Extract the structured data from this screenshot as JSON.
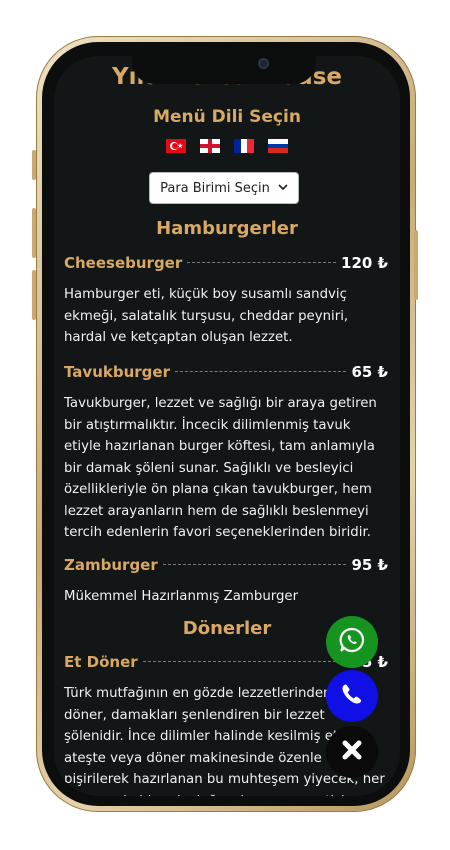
{
  "restaurant": {
    "name": "Yıldız Steakhouse"
  },
  "language": {
    "title": "Menü Dili Seçin",
    "flags": [
      {
        "code": "tr",
        "name": "Turkish flag"
      },
      {
        "code": "en",
        "name": "English flag"
      },
      {
        "code": "fr",
        "name": "French flag"
      },
      {
        "code": "ru",
        "name": "Russian flag"
      }
    ]
  },
  "currency": {
    "label": "Para Birimi Seçin"
  },
  "sections": [
    {
      "title": "Hamburgerler",
      "items": [
        {
          "name": "Cheeseburger",
          "price": "120 ₺",
          "description": "Hamburger eti, küçük boy susamlı sandviç ekmeği, salatalık turşusu, cheddar peyniri, hardal ve ketçaptan oluşan lezzet."
        },
        {
          "name": "Tavukburger",
          "price": "65 ₺",
          "description": "Tavukburger, lezzet ve sağlığı bir araya getiren bir atıştırmalıktır. İncecik dilimlenmiş tavuk etiyle hazırlanan burger köftesi, tam anlamıyla bir damak şöleni sunar. Sağlıklı ve besleyici özellikleriyle ön plana çıkan tavukburger, hem lezzet arayanların hem de sağlıklı beslenmeyi tercih edenlerin favori seçeneklerinden biridir."
        },
        {
          "name": "Zamburger",
          "price": "95 ₺",
          "description": "Mükemmel Hazırlanmış Zamburger"
        }
      ]
    },
    {
      "title": "Dönerler",
      "items": [
        {
          "name": "Et Döner",
          "price": "95 ₺",
          "description": "Türk mutfağının en gözde lezzetlerinden biri et döner, damakları şenlendiren bir lezzet şölenidir. İnce dilimler halinde kesilmiş et, ateşte veya döner makinesinde özenle pişirilerek hazırlanan bu muhteşem yiyecek, her lokmasıyla bir yolculuğa çıkarma garantisi verir."
        }
      ]
    }
  ],
  "actions": {
    "whatsapp": "whatsapp-icon",
    "phone": "phone-icon",
    "close": "close-icon"
  },
  "colors": {
    "screen_background": "#121616",
    "accent_gold": "#d8a864",
    "whatsapp_green": "#15951f",
    "phone_blue": "#1010e6"
  }
}
